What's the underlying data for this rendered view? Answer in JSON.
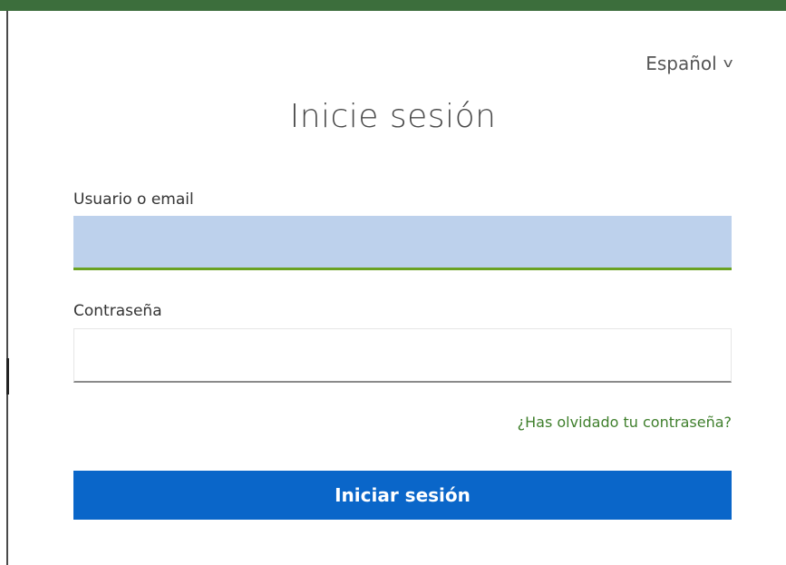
{
  "header": {
    "language_label": "Español",
    "language_chevron": "v"
  },
  "form": {
    "title": "Inicie sesión",
    "username_label": "Usuario o email",
    "username_value": "",
    "password_label": "Contraseña",
    "password_value": "",
    "forgot_password": "¿Has olvidado tu contraseña?",
    "submit_label": "Iniciar sesión"
  },
  "colors": {
    "top_bar": "#3c6e3c",
    "focused_input_bg": "#bdd1ec",
    "focused_input_underline": "#6aa222",
    "link": "#3f7f2c",
    "primary_button": "#0a66c9"
  }
}
